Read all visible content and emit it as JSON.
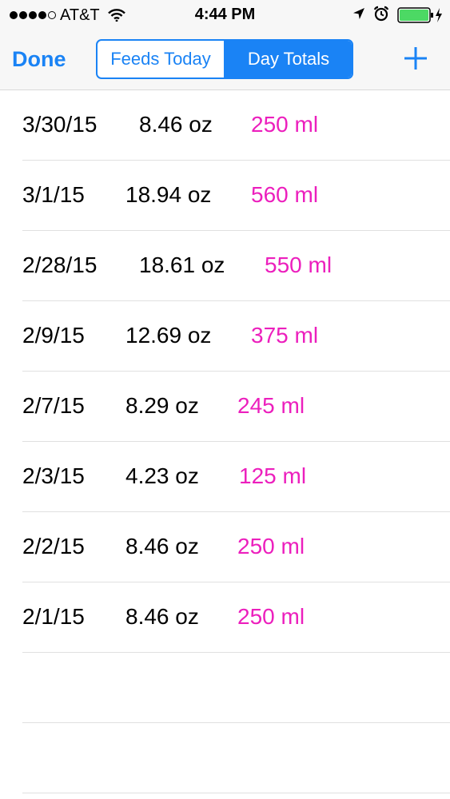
{
  "status_bar": {
    "carrier": "AT&T",
    "time": "4:44 PM",
    "signal_icon": "signal-dots-icon",
    "wifi_icon": "wifi-icon",
    "location_icon": "location-arrow-icon",
    "alarm_icon": "alarm-clock-icon",
    "battery_icon": "battery-charging-icon",
    "battery_color": "#4cd964"
  },
  "nav": {
    "done_label": "Done",
    "segments": [
      "Feeds Today",
      "Day Totals"
    ],
    "selected_segment": "Day Totals",
    "add_icon": "plus-icon",
    "accent_color": "#1a83f5"
  },
  "rows": [
    {
      "date": "3/30/15",
      "oz": "8.46 oz",
      "ml": "250 ml"
    },
    {
      "date": "3/1/15",
      "oz": "18.94 oz",
      "ml": "560 ml"
    },
    {
      "date": "2/28/15",
      "oz": "18.61 oz",
      "ml": "550 ml"
    },
    {
      "date": "2/9/15",
      "oz": "12.69 oz",
      "ml": "375 ml"
    },
    {
      "date": "2/7/15",
      "oz": "8.29 oz",
      "ml": "245 ml"
    },
    {
      "date": "2/3/15",
      "oz": "4.23 oz",
      "ml": "125 ml"
    },
    {
      "date": "2/2/15",
      "oz": "8.46 oz",
      "ml": "250 ml"
    },
    {
      "date": "2/1/15",
      "oz": "8.46 oz",
      "ml": "250 ml"
    }
  ],
  "ml_color": "#ec1fbd"
}
